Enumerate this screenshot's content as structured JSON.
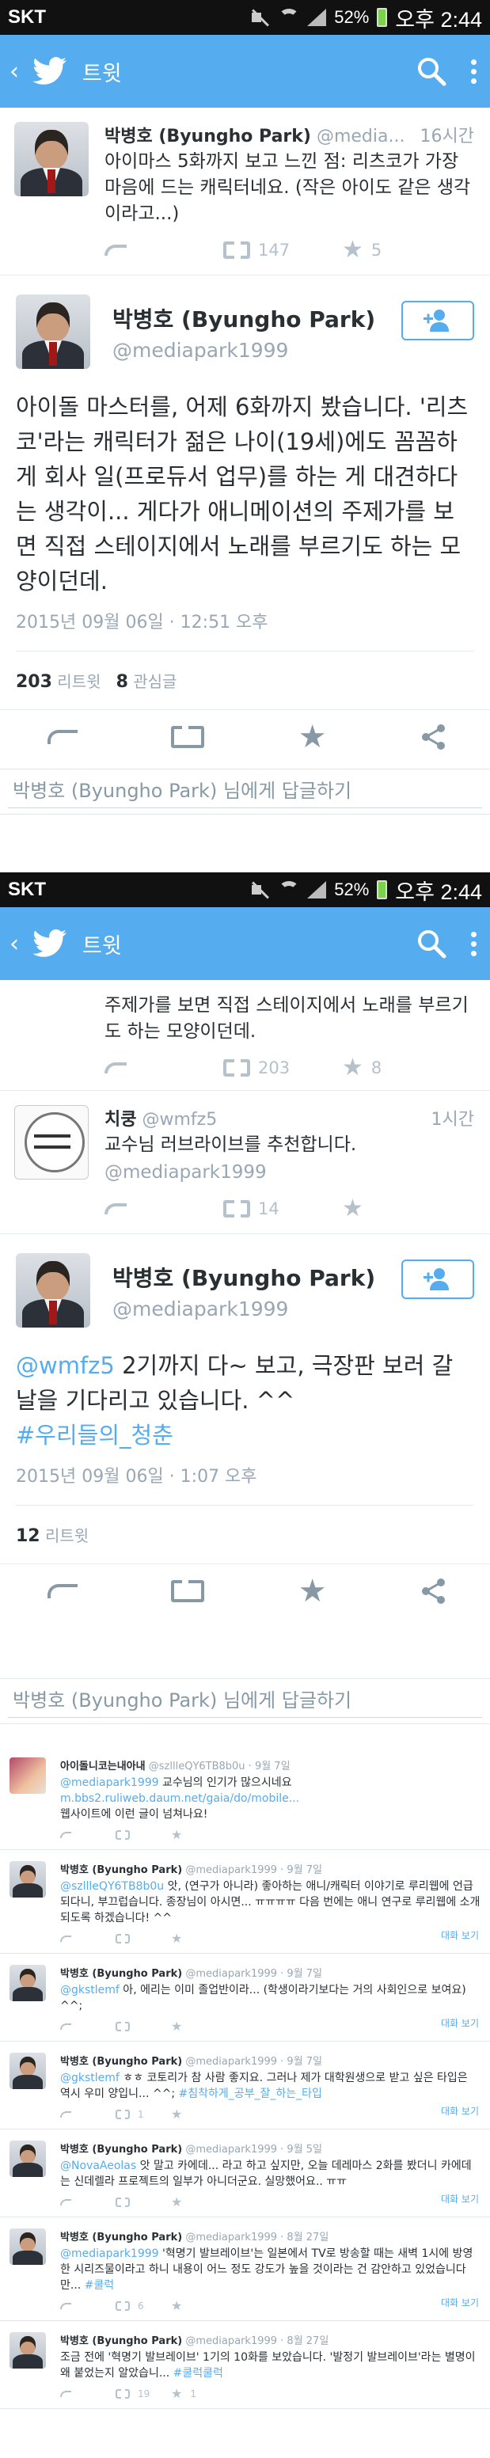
{
  "status": {
    "carrier": "SKT",
    "battery": "52%",
    "time": "오후 2:44"
  },
  "appbar": {
    "title": "트윗"
  },
  "screen1": {
    "prev_tweet": {
      "name": "박병호 (Byungho Park)",
      "handle": "@media...",
      "time": "16시간",
      "text": "아이마스 5화까지 보고 느낀 점: 리츠코가 가장 마음에 드는 캐릭터네요. (작은 아이도 같은 생각이라고...)",
      "retweets": "147",
      "favorites": "5"
    },
    "main": {
      "name": "박병호 (Byungho Park)",
      "handle": "@mediapark1999",
      "text": "아이돌 마스터를, 어제 6화까지 봤습니다. '리츠코'라는 캐릭터가 젊은 나이(19세)에도 꼼꼼하게 회사 일(프로듀서 업무)를 하는 게 대견하다는 생각이... 게다가 애니메이션의 주제가를 보면 직접 스테이지에서 노래를 부르기도 하는 모양이던데.",
      "date": "2015년 09월 06일 · 12:51 오후",
      "retweets": "203",
      "retweets_label": "리트윗",
      "favorites": "8",
      "favorites_label": "관심글"
    },
    "reply_placeholder": "박병호 (Byungho Park) 님에게 답글하기"
  },
  "screen2": {
    "cut_text": "주제가를 보면 직접 스테이지에서 노래를 부르기도 하는 모양이던데.",
    "cut_retweets": "203",
    "cut_favorites": "8",
    "reply1": {
      "name": "치쿵",
      "handle": "@wmfz5",
      "time": "1시간",
      "text": "교수님 러브라이브를 추천합니다.",
      "mention": "@mediapark1999",
      "retweets": "14"
    },
    "main": {
      "name": "박병호 (Byungho Park)",
      "handle": "@mediapark1999",
      "mention": "@wmfz5",
      "text": " 2기까지 다~ 보고, 극장판 보러 갈 날을 기다리고 있습니다. ^^",
      "hashtag": "#우리들의_청춘",
      "date": "2015년 09월 06일 · 1:07 오후",
      "retweets": "12",
      "retweets_label": "리트윗"
    },
    "reply_placeholder": "박병호 (Byungho Park) 님에게 답글하기"
  },
  "thread": [
    {
      "avatar": "anime",
      "name": "아이돌니코는내아내",
      "handle": "@szllleQY6TB8b0u · 9월 7일",
      "mention": "@mediapark1999",
      "text": " 교수님의 인기가 많으시네요",
      "extra": "m.bbs2.ruliweb.daum.net/gaia/do/mobile...",
      "extra2": "웹사이트에 이런 글이 넘쳐나요!",
      "rt": "",
      "fav": "",
      "reply": ""
    },
    {
      "avatar": "park",
      "name": "박병호 (Byungho Park)",
      "handle": "@mediapark1999 · 9월 7일",
      "mention": "@szllleQY6TB8b0u",
      "text": " 앗, (연구가 아니라) 좋아하는 애니/캐릭터 이야기로 루리웹에 언급 되다니, 부끄럽습니다. 종장님이 아시면... ㅠㅠㅠㅠ 다음 번에는 애니 연구로 루리웹에 소개되도록 하겠습니다! ^^",
      "extra": "",
      "extra2": "",
      "rt": "",
      "fav": "",
      "reply": "대화 보기"
    },
    {
      "avatar": "park",
      "name": "박병호 (Byungho Park)",
      "handle": "@mediapark1999 · 9월 7일",
      "mention": "@gkstlemf",
      "text": " 아, 에리는 이미 졸업반이라... (학생이라기보다는 거의 사회인으로 보여요) ^^;",
      "extra": "",
      "extra2": "",
      "rt": "",
      "fav": "",
      "reply": "대화 보기"
    },
    {
      "avatar": "park",
      "name": "박병호 (Byungho Park)",
      "handle": "@mediapark1999 · 9월 7일",
      "mention": "@gkstlemf",
      "text": " ㅎㅎ 코토리가 참 사람 좋지요. 그러나 제가 대학원생으로 받고 싶은 타입은 역시 우미 양입니... ^^; ",
      "hashtag": "#침착하게_공부_잘_하는_타입",
      "extra": "",
      "extra2": "",
      "rt": "1",
      "fav": "",
      "reply": "대화 보기"
    },
    {
      "avatar": "park",
      "name": "박병호 (Byungho Park)",
      "handle": "@mediapark1999 · 9월 5일",
      "mention": "@NovaAeolas",
      "text": " 앗 말고 카에데... 라고 하고 싶지만, 오늘 데레마스 2화를 봤더니 카에데는 신데렐라 프로젝트의 일부가 아니더군요. 실망했어요.. ㅠㅠ",
      "extra": "",
      "extra2": "",
      "rt": "",
      "fav": "",
      "reply": "대화 보기"
    },
    {
      "avatar": "park",
      "name": "박병호 (Byungho Park)",
      "handle": "@mediapark1999 · 8월 27일",
      "mention": "@mediapark1999",
      "text": " '혁명기 발브레이브'는 일본에서 TV로 방송할 때는 새벽 1시에 방영한 시리즈물이라고 하니 내용이 어느 정도 강도가 높을 것이라는 건 감안하고 있었습니다만... ",
      "hashtag": "#쿨럭",
      "extra": "",
      "extra2": "",
      "rt": "6",
      "fav": "",
      "reply": "대화 보기"
    },
    {
      "avatar": "park",
      "name": "박병호 (Byungho Park)",
      "handle": "@mediapark1999 · 8월 27일",
      "mention": "",
      "text": "조금 전에 '혁명기 발브레이브' 1기의 10화를 보았습니다. '발정기 발브레이브'라는 별명이 왜 붙었는지 알았습니... ",
      "hashtag": "#쿨럭쿨럭",
      "extra": "",
      "extra2": "",
      "rt": "19",
      "fav": "1",
      "reply": ""
    }
  ]
}
